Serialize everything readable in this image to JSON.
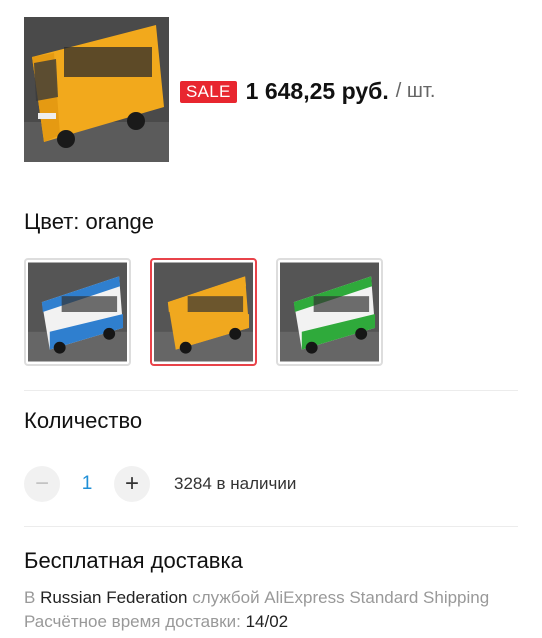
{
  "product": {
    "sale_badge": "SALE",
    "price": "1 648,25 руб.",
    "unit": "/ шт."
  },
  "color": {
    "label": "Цвет: orange",
    "options": [
      {
        "name": "blue",
        "body": "#f2f2f2",
        "accent": "#2f7fcf"
      },
      {
        "name": "orange",
        "body": "#f0a81f",
        "accent": "#f0a81f"
      },
      {
        "name": "green",
        "body": "#f2f2f2",
        "accent": "#2faa3b"
      }
    ],
    "selected_index": 1,
    "selected_border": "#e8434a"
  },
  "quantity": {
    "title": "Количество",
    "minus_icon": "−",
    "plus_icon": "+",
    "value": "1",
    "stock": "3284 в наличии"
  },
  "shipping": {
    "title": "Бесплатная доставка",
    "line1_prefix": "В ",
    "line1_country": "Russian Federation",
    "line1_suffix": " службой AliExpress Standard Shipping",
    "line2_label": "Расчётное время доставки: ",
    "line2_date": "14/02"
  }
}
